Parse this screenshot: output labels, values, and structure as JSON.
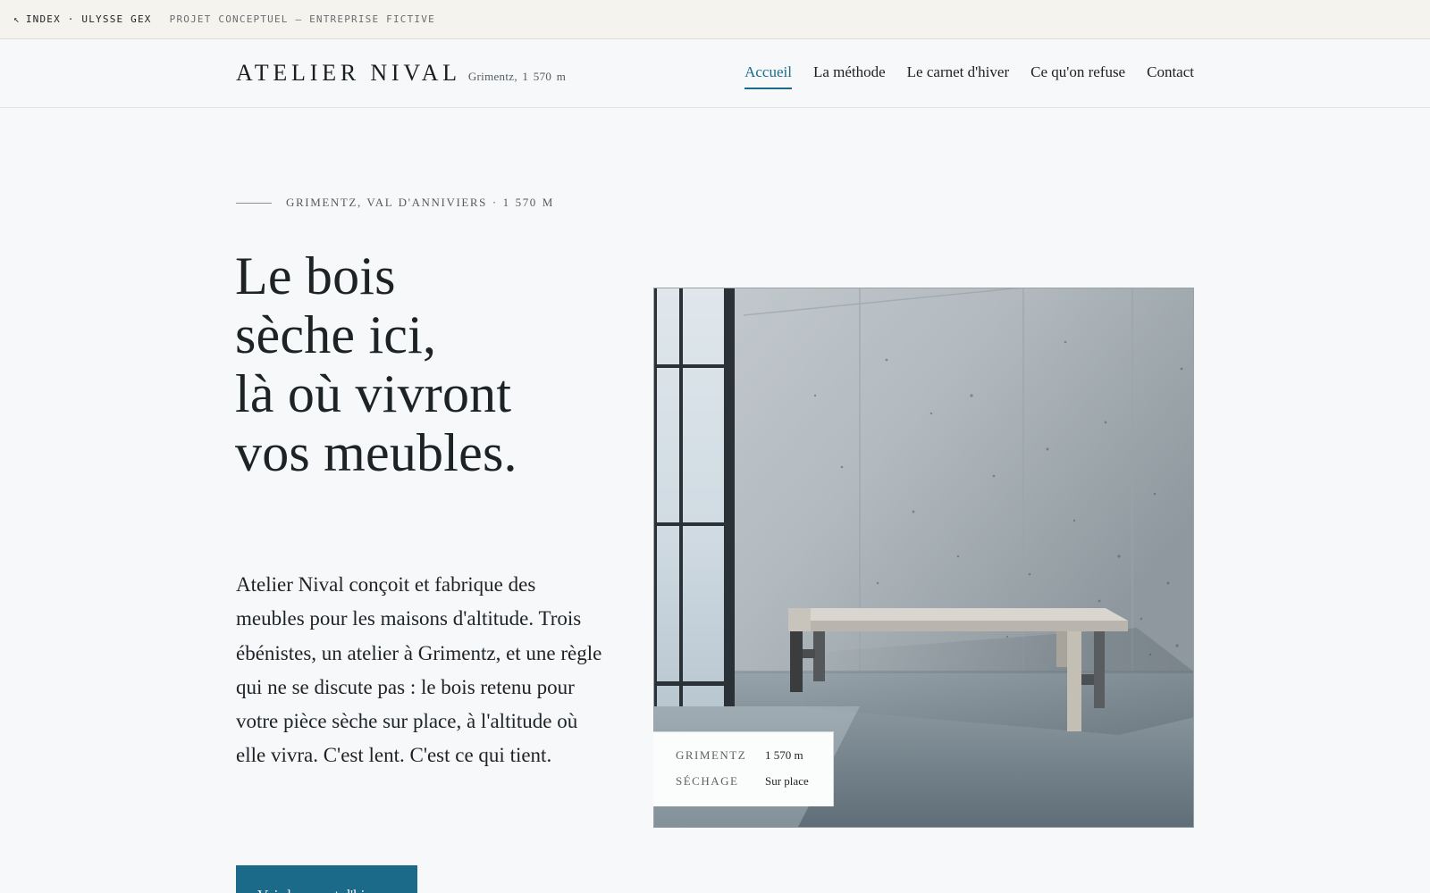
{
  "meta_strip": {
    "index_label": "INDEX · ULYSSE GEX",
    "project_note": "PROJET CONCEPTUEL — ENTREPRISE FICTIVE"
  },
  "header": {
    "brand_name": "ATELIER NIVAL",
    "brand_place": "Grimentz, 1 570 m",
    "nav": [
      {
        "label": "Accueil",
        "active": true
      },
      {
        "label": "La méthode",
        "active": false
      },
      {
        "label": "Le carnet d'hiver",
        "active": false
      },
      {
        "label": "Ce qu'on refuse",
        "active": false
      },
      {
        "label": "Contact",
        "active": false
      }
    ]
  },
  "hero": {
    "eyebrow": "Grimentz, Val d'Anniviers · 1 570 m",
    "headline_lines": [
      "Le bois",
      "sèche ici,",
      "là où vivront",
      "vos meubles."
    ],
    "lead": "Atelier Nival conçoit et fabrique des meubles pour les maisons d'altitude. Trois ébénistes, un atelier à Grimentz, et une règle qui ne se discute pas : le bois retenu pour votre pièce sèche sur place, à l'altitude où elle vivra. C'est lent. C'est ce qui tient.",
    "cta_label": "Voir le carnet d'hiver"
  },
  "spec_card": {
    "rows": [
      {
        "label": "Grimentz",
        "value": "1 570 m"
      },
      {
        "label": "Séchage",
        "value": "Sur place"
      }
    ]
  },
  "colors": {
    "accent": "#1b6a8a",
    "background": "#f6f8fa",
    "meta_strip_bg": "#f4f3ee",
    "text": "#1d2225"
  },
  "icons": {
    "back_arrow": "arrow-up-left-icon"
  }
}
